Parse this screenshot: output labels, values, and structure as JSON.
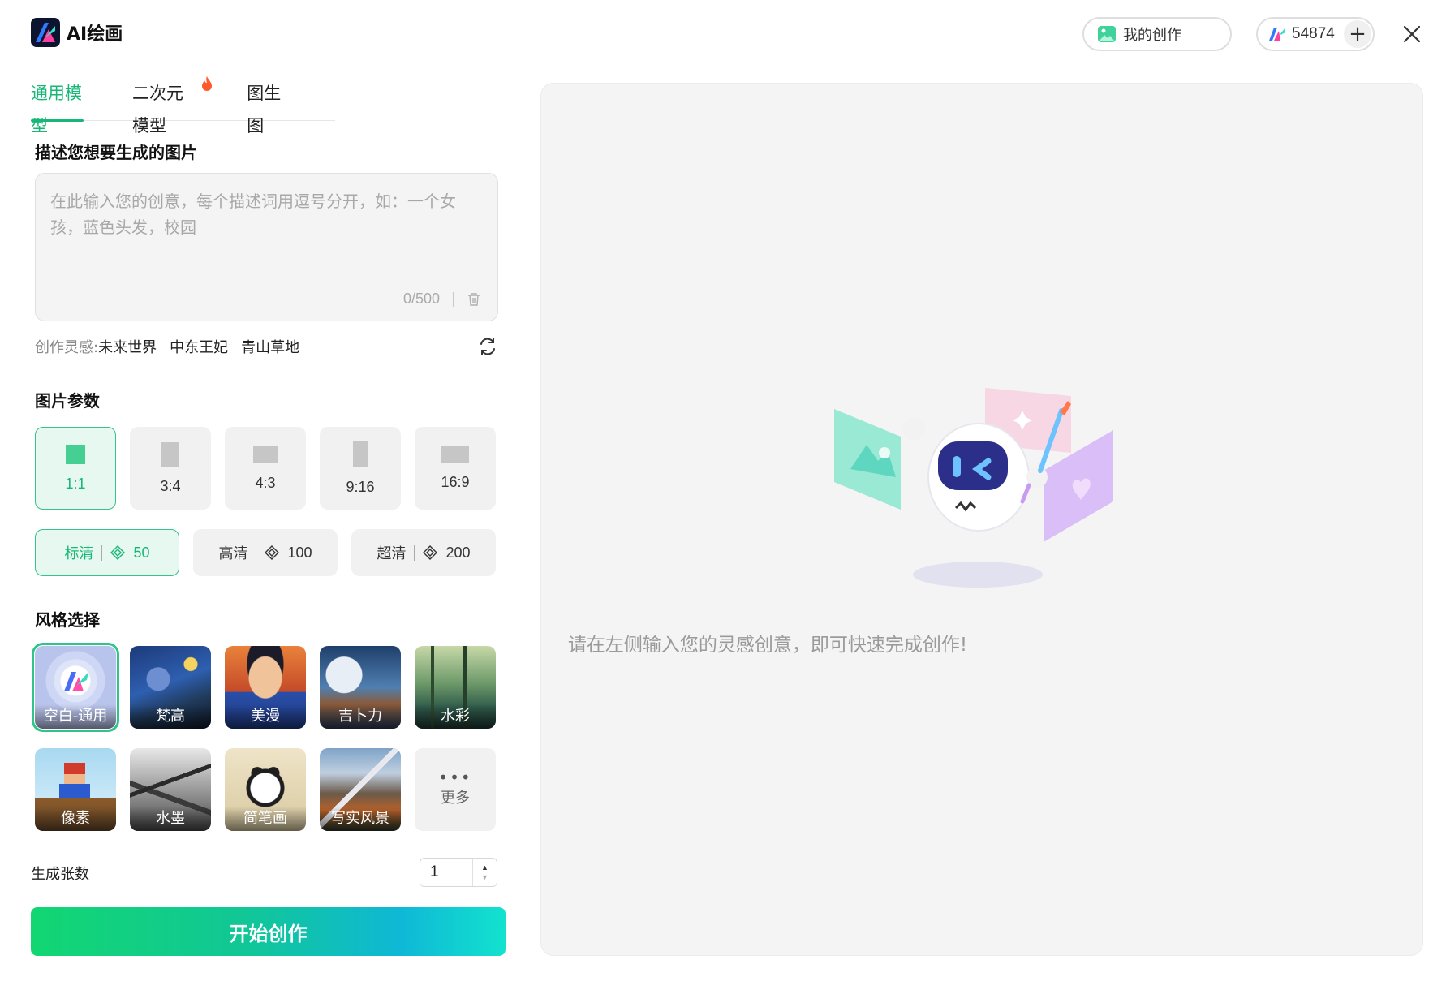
{
  "app": {
    "title": "AI绘画"
  },
  "header": {
    "my_works_label": "我的创作",
    "points_value": "54874",
    "plus_icon": "plus-icon",
    "close_icon": "close-icon"
  },
  "tabs": [
    {
      "label": "通用模型",
      "active": true
    },
    {
      "label": "二次元模型",
      "active": false,
      "badge_icon": "fire-icon"
    },
    {
      "label": "图生图",
      "active": false
    }
  ],
  "prompt": {
    "section_title": "描述您想要生成的图片",
    "placeholder": "在此输入您的创意，每个描述词用逗号分开，如：一个女孩，蓝色头发，校园",
    "value": "",
    "counter": "0/500",
    "clear_icon": "trash-icon"
  },
  "inspiration": {
    "label": "创作灵感:",
    "items": [
      "未来世界",
      "中东王妃",
      "青山草地"
    ],
    "refresh_icon": "refresh-icon"
  },
  "params": {
    "section_title": "图片参数",
    "ratios": [
      {
        "label": "1:1",
        "active": true
      },
      {
        "label": "3:4",
        "active": false
      },
      {
        "label": "4:3",
        "active": false
      },
      {
        "label": "9:16",
        "active": false
      },
      {
        "label": "16:9",
        "active": false
      }
    ],
    "qualities": [
      {
        "label": "标清",
        "cost": "50",
        "active": true
      },
      {
        "label": "高清",
        "cost": "100",
        "active": false
      },
      {
        "label": "超清",
        "cost": "200",
        "active": false
      }
    ]
  },
  "styles": {
    "section_title": "风格选择",
    "items": [
      {
        "label": "空白-通用",
        "active": true
      },
      {
        "label": "梵高",
        "active": false
      },
      {
        "label": "美漫",
        "active": false
      },
      {
        "label": "吉卜力",
        "active": false
      },
      {
        "label": "水彩",
        "active": false
      },
      {
        "label": "像素",
        "active": false
      },
      {
        "label": "水墨",
        "active": false
      },
      {
        "label": "简笔画",
        "active": false
      },
      {
        "label": "写实风景",
        "active": false
      }
    ],
    "more_label": "更多"
  },
  "count": {
    "label": "生成张数",
    "value": "1"
  },
  "start_button": "开始创作",
  "canvas": {
    "empty_text": "请在左侧输入您的灵感创意，即可快速完成创作!"
  },
  "colors": {
    "accent": "#18b777",
    "canvas_bg": "#f4f4f4"
  }
}
